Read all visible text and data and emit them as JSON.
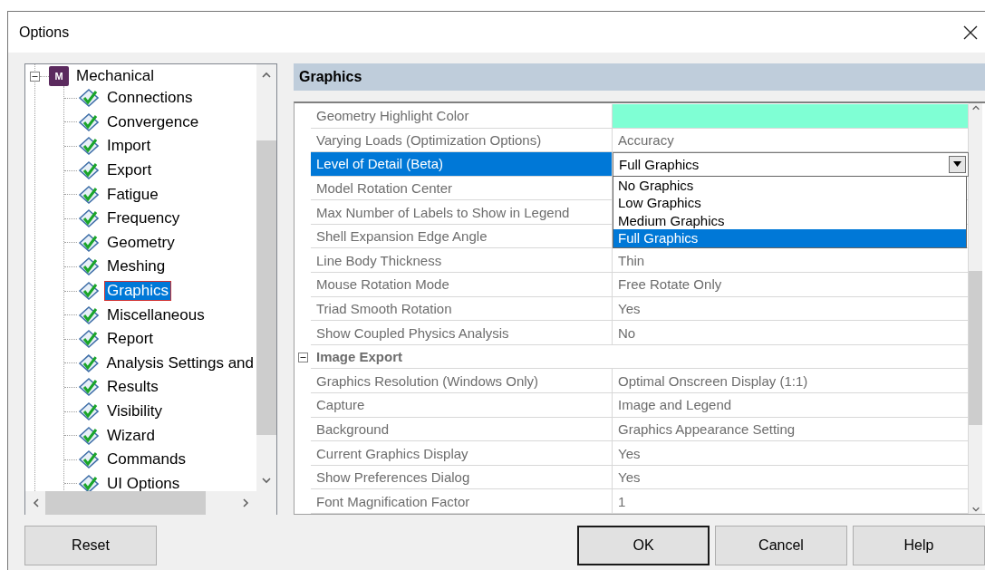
{
  "window": {
    "title": "Options"
  },
  "tree": {
    "label": "Mechanical",
    "icon_letter": "M",
    "expanded": true,
    "children": [
      {
        "label": "Connections",
        "selected": false
      },
      {
        "label": "Convergence",
        "selected": false
      },
      {
        "label": "Import",
        "selected": false
      },
      {
        "label": "Export",
        "selected": false
      },
      {
        "label": "Fatigue",
        "selected": false
      },
      {
        "label": "Frequency",
        "selected": false
      },
      {
        "label": "Geometry",
        "selected": false
      },
      {
        "label": "Meshing",
        "selected": false
      },
      {
        "label": "Graphics",
        "selected": true
      },
      {
        "label": "Miscellaneous",
        "selected": false
      },
      {
        "label": "Report",
        "selected": false
      },
      {
        "label": "Analysis Settings and",
        "selected": false
      },
      {
        "label": "Results",
        "selected": false
      },
      {
        "label": "Visibility",
        "selected": false
      },
      {
        "label": "Wizard",
        "selected": false
      },
      {
        "label": "Commands",
        "selected": false
      },
      {
        "label": "UI Options",
        "selected": false
      }
    ]
  },
  "panel": {
    "title": "Graphics",
    "rows": [
      {
        "kind": "color",
        "name": "Geometry Highlight Color",
        "color": "#7fffd4",
        "selected": false
      },
      {
        "kind": "property",
        "name": "Varying Loads (Optimization Options)",
        "value": "Accuracy",
        "selected": false
      },
      {
        "kind": "dropdown",
        "name": "Level of Detail (Beta)",
        "value": "Full Graphics",
        "selected": true,
        "options": [
          {
            "label": "No Graphics",
            "selected": false
          },
          {
            "label": "Low Graphics",
            "selected": false
          },
          {
            "label": "Medium Graphics",
            "selected": false
          },
          {
            "label": "Full Graphics",
            "selected": true
          }
        ]
      },
      {
        "kind": "property",
        "name": "Model Rotation Center",
        "selected": false
      },
      {
        "kind": "property",
        "name": "Max Number of Labels to Show in Legend",
        "selected": false
      },
      {
        "kind": "property",
        "name": "Shell Expansion Edge Angle",
        "selected": false
      },
      {
        "kind": "property",
        "name": "Line Body Thickness",
        "value": "Thin",
        "selected": false
      },
      {
        "kind": "property",
        "name": "Mouse Rotation Mode",
        "value": "Free Rotate Only",
        "selected": false
      },
      {
        "kind": "property",
        "name": "Triad Smooth Rotation",
        "value": "Yes",
        "selected": false
      },
      {
        "kind": "property",
        "name": "Show Coupled Physics Analysis",
        "value": "No",
        "selected": false
      },
      {
        "kind": "category",
        "name": "Image Export",
        "expanded": true
      },
      {
        "kind": "property",
        "name": "Graphics Resolution (Windows Only)",
        "value": "Optimal Onscreen Display (1:1)",
        "selected": false
      },
      {
        "kind": "property",
        "name": "Capture",
        "value": "Image and Legend",
        "selected": false
      },
      {
        "kind": "property",
        "name": "Background",
        "value": "Graphics Appearance Setting",
        "selected": false
      },
      {
        "kind": "property",
        "name": "Current Graphics Display",
        "value": "Yes",
        "selected": false
      },
      {
        "kind": "property",
        "name": "Show Preferences Dialog",
        "value": "Yes",
        "selected": false
      },
      {
        "kind": "property",
        "name": "Font Magnification Factor",
        "value": "1",
        "selected": false
      }
    ]
  },
  "buttons": {
    "left": [
      {
        "label": "Reset",
        "default": false
      }
    ],
    "right": [
      {
        "label": "OK",
        "default": true
      },
      {
        "label": "Cancel",
        "default": false
      },
      {
        "label": "Help",
        "default": false
      }
    ]
  }
}
